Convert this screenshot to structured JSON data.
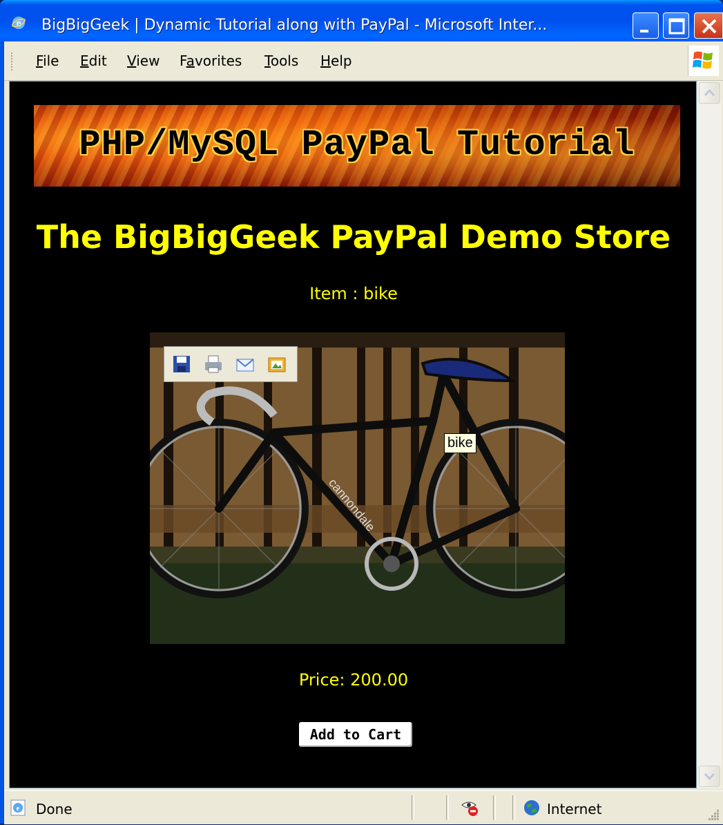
{
  "window": {
    "title": "BigBigGeek | Dynamic Tutorial along with PayPal - Microsoft Inter..."
  },
  "menu": [
    {
      "first": "F",
      "rest": "ile"
    },
    {
      "first": "E",
      "rest": "dit"
    },
    {
      "first": "V",
      "rest": "iew"
    },
    {
      "pre": "F",
      "first": "a",
      "rest": "vorites"
    },
    {
      "first": "T",
      "rest": "ools"
    },
    {
      "first": "H",
      "rest": "elp"
    }
  ],
  "page": {
    "banner_text": "PHP/MySQL PayPal Tutorial",
    "store_title": "The BigBigGeek PayPal Demo Store",
    "item_line": "Item : bike",
    "image_tooltip": "bike",
    "price_line": "Price: 200.00",
    "add_to_cart_label": "Add to Cart"
  },
  "status": {
    "text": "Done",
    "zone": "Internet"
  },
  "colors": {
    "page_bg": "#000000",
    "text_accent": "#ffff00",
    "titlebar": "#0054e3"
  },
  "icons": [
    "ie-icon",
    "minimize-icon",
    "maximize-icon",
    "close-icon",
    "windows-flag-icon",
    "save-icon",
    "print-icon",
    "email-icon",
    "my-pictures-icon",
    "privacy-icon",
    "globe-icon"
  ]
}
